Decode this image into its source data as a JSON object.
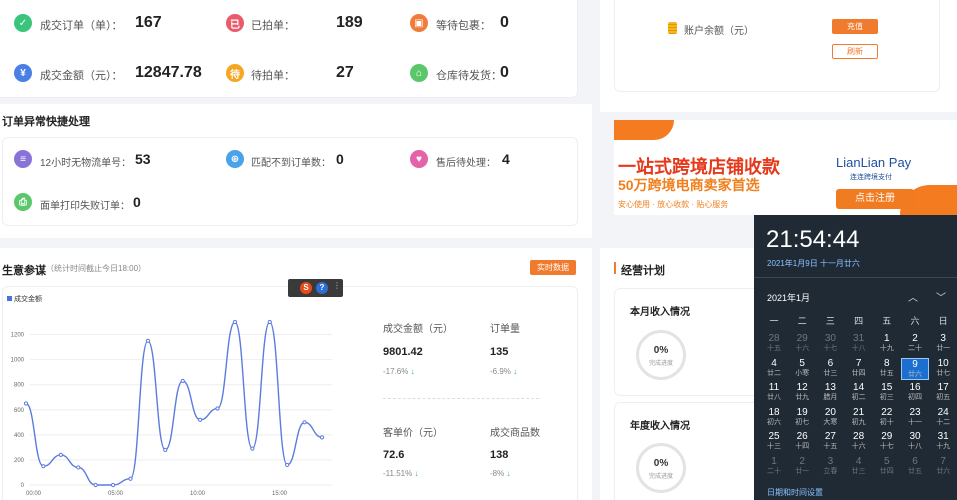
{
  "stats": [
    {
      "label": "成交订单（单）：",
      "value": "167",
      "icon": "check-circle-icon",
      "color": "#3bc47b"
    },
    {
      "label": "已拍单：",
      "value": "189",
      "icon": "badge-icon",
      "color": "#e95a6b"
    },
    {
      "label": "等待包裹：",
      "value": "0",
      "icon": "package-icon",
      "color": "#f07b3a"
    },
    {
      "label": "成交金额（元）：",
      "value": "12847.78",
      "icon": "coins-icon",
      "color": "#4a7fe5"
    },
    {
      "label": "待拍单：",
      "value": "27",
      "icon": "pending-icon",
      "color": "#f5a623"
    },
    {
      "label": "仓库待发货：",
      "value": "0",
      "icon": "warehouse-icon",
      "color": "#5ac86a"
    }
  ],
  "balance": {
    "label": "账户余额（元）",
    "recharge": "充值",
    "refresh": "刷新"
  },
  "exceptions": {
    "title": "订单异常快捷处理",
    "items": [
      {
        "label": "12小时无物流单号：",
        "value": "53",
        "icon": "document-icon",
        "color": "#8a73d8"
      },
      {
        "label": "匹配不到订单数：",
        "value": "0",
        "icon": "target-icon",
        "color": "#4aa3e8"
      },
      {
        "label": "售后待处理：",
        "value": "4",
        "icon": "service-icon",
        "color": "#e561a8"
      },
      {
        "label": "面单打印失败订单：",
        "value": "0",
        "icon": "printer-icon",
        "color": "#5ac86a"
      }
    ]
  },
  "banner": {
    "line1": "一站式跨境店铺收款",
    "line2": "50万跨境电商卖家首选",
    "line3": "安心使用 · 放心收款 · 贴心服务",
    "brand": "LianLian Pay",
    "brand_sub": "连连跨境支付",
    "cta": "点击注册"
  },
  "business": {
    "title": "生意参谋",
    "subtitle": "（统计时间截止今日18:00）",
    "realtime": "实时数据",
    "kpis": [
      {
        "label": "成交金额（元）",
        "value": "9801.42",
        "change": "-17.6%"
      },
      {
        "label": "订单量",
        "value": "135",
        "change": "-6.9%"
      },
      {
        "label": "客单价（元）",
        "value": "72.6",
        "change": "-11.51%"
      },
      {
        "label": "成交商品数",
        "value": "138",
        "change": "-8%"
      }
    ]
  },
  "chart_data": {
    "type": "line",
    "series": [
      {
        "name": "成交金额",
        "color": "#4e6fe0",
        "values": [
          650,
          150,
          240,
          140,
          0,
          0,
          50,
          1150,
          280,
          830,
          520,
          610,
          1300,
          290,
          1300,
          160,
          500,
          380
        ]
      }
    ],
    "ylim": [
      0,
      1300
    ],
    "yticks": [
      0,
      200,
      400,
      600,
      800,
      1000,
      1200
    ],
    "xticks": [
      "00:00",
      "05:00",
      "10:00",
      "15:00"
    ]
  },
  "plan": {
    "title": "经营计划",
    "monthly": {
      "title": "本月收入情况",
      "percent": "0%",
      "caption": "完成进度"
    },
    "yearly": {
      "title": "年度收入情况",
      "percent": "0%",
      "caption": "完成进度"
    }
  },
  "clock": {
    "time": "21:54:44",
    "date": "2021年1月9日 十一月廿六",
    "month": "2021年1月",
    "settings": "日期和时间设置",
    "weekdays": [
      "一",
      "二",
      "三",
      "四",
      "五",
      "六",
      "日"
    ],
    "days": [
      {
        "n": "28",
        "l": "十五",
        "dim": true
      },
      {
        "n": "29",
        "l": "十六",
        "dim": true
      },
      {
        "n": "30",
        "l": "十七",
        "dim": true
      },
      {
        "n": "31",
        "l": "十八",
        "dim": true
      },
      {
        "n": "1",
        "l": "十九"
      },
      {
        "n": "2",
        "l": "二十"
      },
      {
        "n": "3",
        "l": "廿一"
      },
      {
        "n": "4",
        "l": "廿二"
      },
      {
        "n": "5",
        "l": "小寒"
      },
      {
        "n": "6",
        "l": "廿三"
      },
      {
        "n": "7",
        "l": "廿四"
      },
      {
        "n": "8",
        "l": "廿五"
      },
      {
        "n": "9",
        "l": "廿六",
        "sel": true
      },
      {
        "n": "10",
        "l": "廿七"
      },
      {
        "n": "11",
        "l": "廿八"
      },
      {
        "n": "12",
        "l": "廿九"
      },
      {
        "n": "13",
        "l": "腊月"
      },
      {
        "n": "14",
        "l": "初二"
      },
      {
        "n": "15",
        "l": "初三"
      },
      {
        "n": "16",
        "l": "初四"
      },
      {
        "n": "17",
        "l": "初五"
      },
      {
        "n": "18",
        "l": "初六"
      },
      {
        "n": "19",
        "l": "初七"
      },
      {
        "n": "20",
        "l": "大寒"
      },
      {
        "n": "21",
        "l": "初九"
      },
      {
        "n": "22",
        "l": "初十"
      },
      {
        "n": "23",
        "l": "十一"
      },
      {
        "n": "24",
        "l": "十二"
      },
      {
        "n": "25",
        "l": "十三"
      },
      {
        "n": "26",
        "l": "十四"
      },
      {
        "n": "27",
        "l": "十五"
      },
      {
        "n": "28",
        "l": "十六"
      },
      {
        "n": "29",
        "l": "十七"
      },
      {
        "n": "30",
        "l": "十八"
      },
      {
        "n": "31",
        "l": "十九"
      },
      {
        "n": "1",
        "l": "二十",
        "dim": true
      },
      {
        "n": "2",
        "l": "廿一",
        "dim": true
      },
      {
        "n": "3",
        "l": "立春",
        "dim": true
      },
      {
        "n": "4",
        "l": "廿三",
        "dim": true
      },
      {
        "n": "5",
        "l": "廿四",
        "dim": true
      },
      {
        "n": "6",
        "l": "廿五",
        "dim": true
      },
      {
        "n": "7",
        "l": "廿六",
        "dim": true
      }
    ]
  }
}
